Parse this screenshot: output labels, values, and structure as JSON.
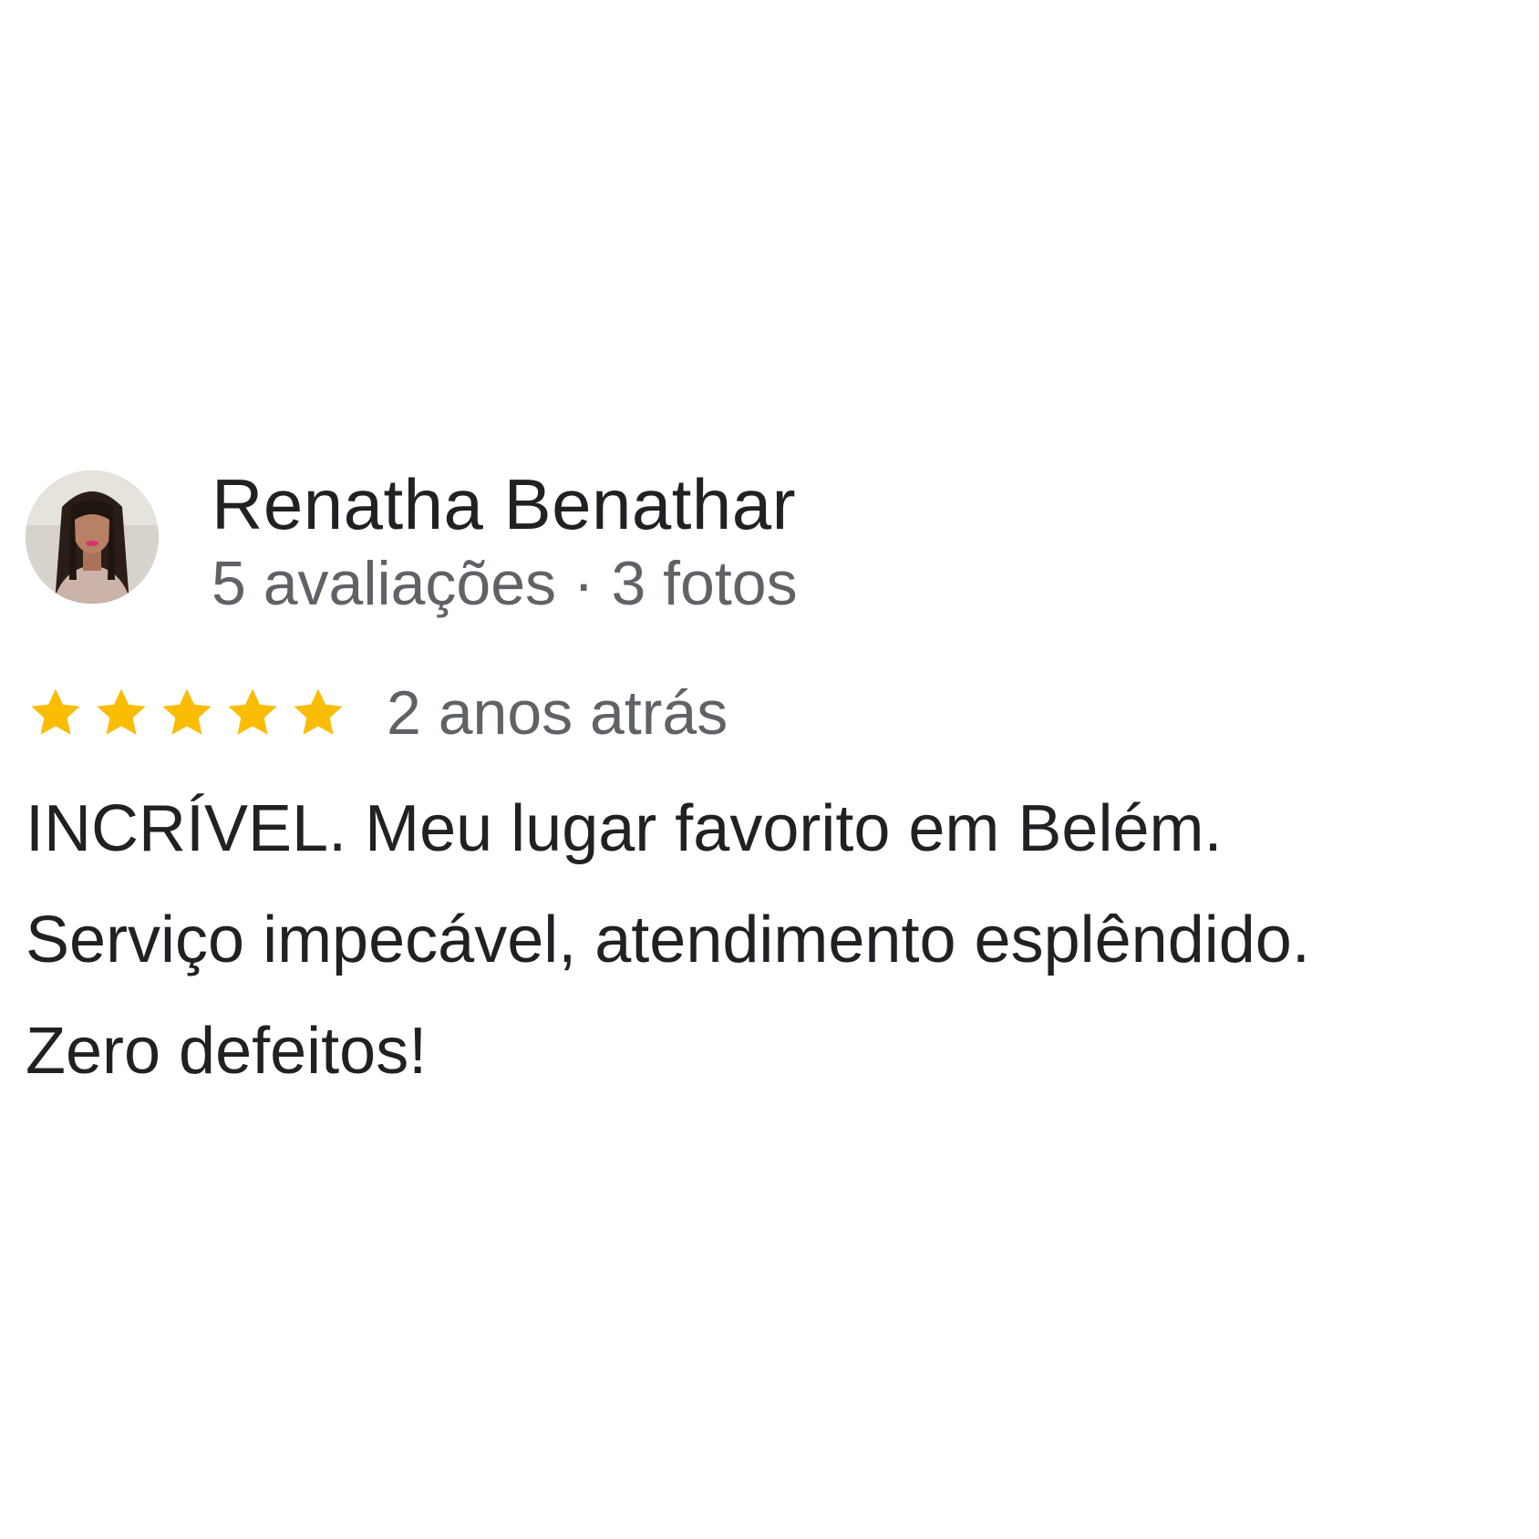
{
  "review": {
    "reviewer": {
      "name": "Renatha Benathar",
      "meta": "5 avaliações · 3 fotos",
      "avatar_icon": "profile-photo"
    },
    "rating": {
      "stars": 5,
      "max_stars": 5,
      "star_color": "#fbbc04",
      "star_icon": "star-icon"
    },
    "date": "2 anos atrás",
    "text_lines": [
      "INCRÍVEL. Meu lugar favorito em Belém.",
      "Serviço impecável, atendimento esplêndido.",
      "Zero defeitos!"
    ]
  }
}
